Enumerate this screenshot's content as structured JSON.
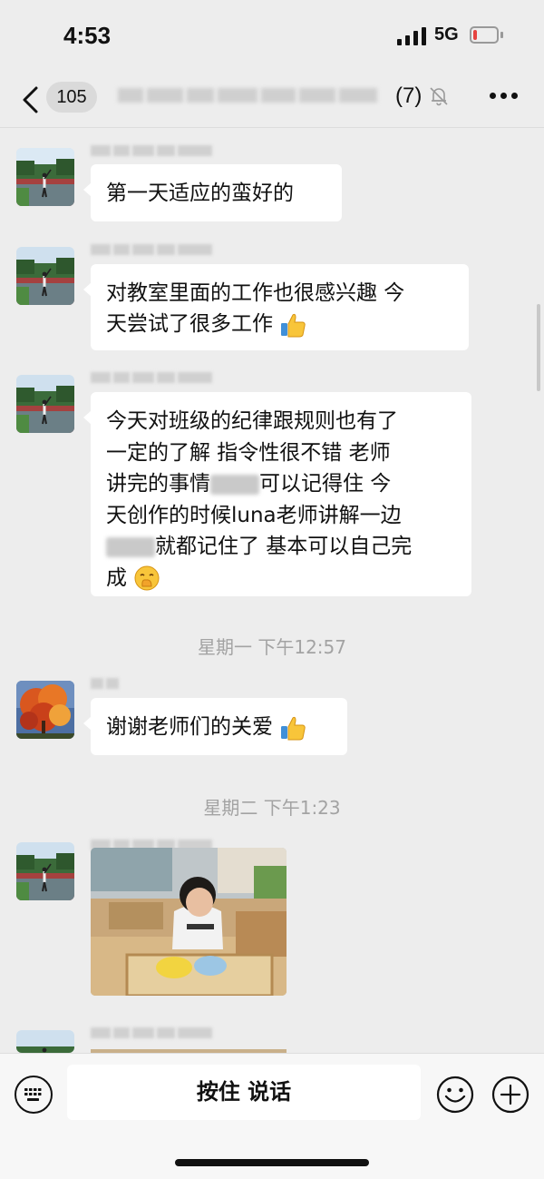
{
  "status_bar": {
    "time": "4:53",
    "network": "5G",
    "battery_level": 0.15
  },
  "nav": {
    "unread_badge": "105",
    "member_count": "(7)"
  },
  "messages": [
    {
      "type": "text",
      "text": "第一天适应的蛮好的"
    },
    {
      "type": "text",
      "text_line1": "对教室里面的工作也很感兴趣 今",
      "text_line2": "天尝试了很多工作",
      "emoji": "thumbs-up"
    },
    {
      "type": "text",
      "line1": "今天对班级的纪律跟规则也有了",
      "line2": "一定的了解 指令性很不错 老师",
      "line3a": "讲完的事情",
      "line3b": "可以记得住 今",
      "line4": "天创作的时候luna老师讲解一边",
      "line5": "就都记住了 基本可以自己完",
      "line6": "成",
      "emoji_end": "shushing-face"
    },
    {
      "type": "timestamp",
      "text": "星期一 下午12:57"
    },
    {
      "type": "text",
      "text": "谢谢老师们的关爱",
      "emoji": "thumbs-up"
    },
    {
      "type": "timestamp",
      "text": "星期二 下午1:23"
    },
    {
      "type": "image",
      "description": "child-at-classroom-table"
    }
  ],
  "input_bar": {
    "voice_button_label": "按住 说话"
  },
  "colors": {
    "background": "#ededed",
    "bubble": "#ffffff",
    "battery_low": "#e64340"
  }
}
